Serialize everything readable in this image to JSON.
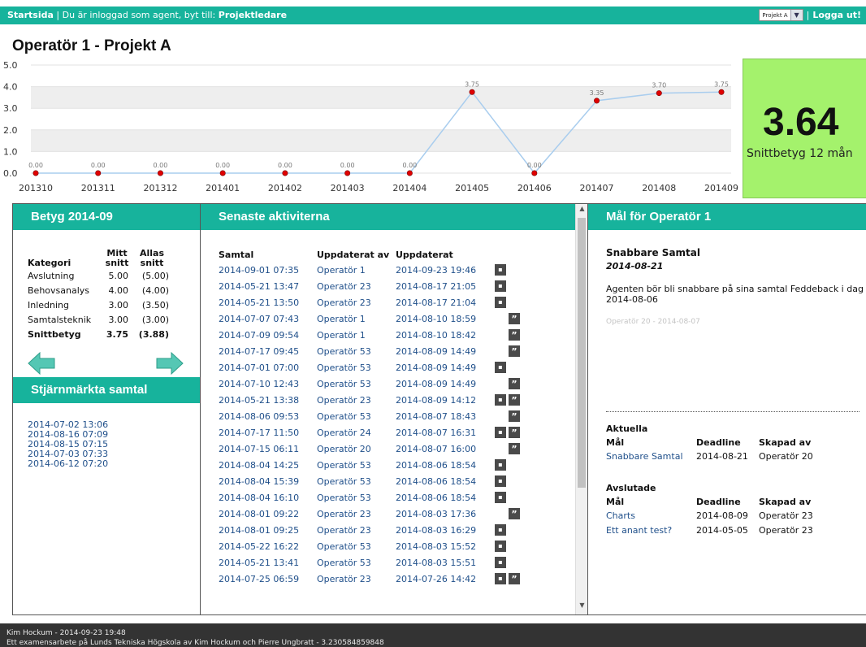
{
  "topbar": {
    "home_link": "Startsida",
    "separator": "|",
    "logged_in_text": "Du är inloggad som agent, byt till:",
    "switch_role": "Projektledare",
    "project_select": "Projekt A",
    "logout": "Logga ut!"
  },
  "page_title": "Operatör 1 - Projekt A",
  "chart_data": {
    "type": "line",
    "categories": [
      "201310",
      "201311",
      "201312",
      "201401",
      "201402",
      "201403",
      "201404",
      "201405",
      "201406",
      "201407",
      "201408",
      "201409"
    ],
    "values": [
      0.0,
      0.0,
      0.0,
      0.0,
      0.0,
      0.0,
      0.0,
      3.75,
      0.0,
      3.35,
      3.7,
      3.75
    ],
    "value_labels": [
      "0.00",
      "0.00",
      "0.00",
      "0.00",
      "0.00",
      "0.00",
      "0.00",
      "3.75",
      "0.00",
      "3.35",
      "3.70",
      "3.75"
    ],
    "y_ticks": [
      "0.0",
      "1.0",
      "2.0",
      "3.0",
      "4.0",
      "5.0"
    ],
    "ylim": [
      0,
      5
    ],
    "grid": true,
    "line_color": "#a9cdee",
    "point_color": "#e00000"
  },
  "score": {
    "value": "3.64",
    "caption": "Snittbetyg 12 mån"
  },
  "betyg": {
    "title": "Betyg 2014-09",
    "col_category": "Kategori",
    "col_mine": "Mitt snitt",
    "col_all": "Allas snitt",
    "rows": [
      {
        "category": "Avslutning",
        "mine": "5.00",
        "all": "(5.00)"
      },
      {
        "category": "Behovsanalys",
        "mine": "4.00",
        "all": "(4.00)"
      },
      {
        "category": "Inledning",
        "mine": "3.00",
        "all": "(3.50)"
      },
      {
        "category": "Samtalsteknik",
        "mine": "3.00",
        "all": "(3.00)"
      }
    ],
    "total": {
      "category": "Snittbetyg",
      "mine": "3.75",
      "all": "(3.88)"
    }
  },
  "starred": {
    "title": "Stjärnmärkta samtal",
    "items": [
      "2014-07-02 13:06",
      "2014-08-16 07:09",
      "2014-08-15 07:15",
      "2014-07-03 07:33",
      "2014-06-12 07:20"
    ]
  },
  "activities": {
    "title": "Senaste aktiviterna",
    "col_call": "Samtal",
    "col_updated_by": "Uppdaterat av",
    "col_updated": "Uppdaterat",
    "rows": [
      {
        "call": "2014-09-01 07:35",
        "by": "Operatör 1",
        "updated": "2014-09-23 19:46",
        "icons": [
          "stats"
        ]
      },
      {
        "call": "2014-05-21 13:47",
        "by": "Operatör 23",
        "updated": "2014-08-17 21:05",
        "icons": [
          "stats"
        ]
      },
      {
        "call": "2014-05-21 13:50",
        "by": "Operatör 23",
        "updated": "2014-08-17 21:04",
        "icons": [
          "stats"
        ]
      },
      {
        "call": "2014-07-07 07:43",
        "by": "Operatör 1",
        "updated": "2014-08-10 18:59",
        "icons": [
          "quote"
        ]
      },
      {
        "call": "2014-07-09 09:54",
        "by": "Operatör 1",
        "updated": "2014-08-10 18:42",
        "icons": [
          "quote"
        ]
      },
      {
        "call": "2014-07-17 09:45",
        "by": "Operatör 53",
        "updated": "2014-08-09 14:49",
        "icons": [
          "quote"
        ]
      },
      {
        "call": "2014-07-01 07:00",
        "by": "Operatör 53",
        "updated": "2014-08-09 14:49",
        "icons": [
          "stats"
        ]
      },
      {
        "call": "2014-07-10 12:43",
        "by": "Operatör 53",
        "updated": "2014-08-09 14:49",
        "icons": [
          "quote"
        ]
      },
      {
        "call": "2014-05-21 13:38",
        "by": "Operatör 23",
        "updated": "2014-08-09 14:12",
        "icons": [
          "stats",
          "quote"
        ]
      },
      {
        "call": "2014-08-06 09:53",
        "by": "Operatör 53",
        "updated": "2014-08-07 18:43",
        "icons": [
          "quote"
        ]
      },
      {
        "call": "2014-07-17 11:50",
        "by": "Operatör 24",
        "updated": "2014-08-07 16:31",
        "icons": [
          "stats",
          "quote"
        ]
      },
      {
        "call": "2014-07-15 06:11",
        "by": "Operatör 20",
        "updated": "2014-08-07 16:00",
        "icons": [
          "quote"
        ]
      },
      {
        "call": "2014-08-04 14:25",
        "by": "Operatör 53",
        "updated": "2014-08-06 18:54",
        "icons": [
          "stats"
        ]
      },
      {
        "call": "2014-08-04 15:39",
        "by": "Operatör 53",
        "updated": "2014-08-06 18:54",
        "icons": [
          "stats"
        ]
      },
      {
        "call": "2014-08-04 16:10",
        "by": "Operatör 53",
        "updated": "2014-08-06 18:54",
        "icons": [
          "stats"
        ]
      },
      {
        "call": "2014-08-01 09:22",
        "by": "Operatör 23",
        "updated": "2014-08-03 17:36",
        "icons": [
          "quote"
        ]
      },
      {
        "call": "2014-08-01 09:25",
        "by": "Operatör 23",
        "updated": "2014-08-03 16:29",
        "icons": [
          "stats"
        ]
      },
      {
        "call": "2014-05-22 16:22",
        "by": "Operatör 53",
        "updated": "2014-08-03 15:52",
        "icons": [
          "stats"
        ]
      },
      {
        "call": "2014-05-21 13:41",
        "by": "Operatör 53",
        "updated": "2014-08-03 15:51",
        "icons": [
          "stats"
        ]
      },
      {
        "call": "2014-07-25 06:59",
        "by": "Operatör 23",
        "updated": "2014-07-26 14:42",
        "icons": [
          "stats",
          "quote"
        ]
      }
    ]
  },
  "goals": {
    "title": "Mål för Operatör 1",
    "current_goal": {
      "title": "Snabbare Samtal",
      "date": "2014-08-21",
      "description": "Agenten bör bli snabbare på sina samtal Feddeback i dag 2014-08-06",
      "meta": "Operatör 20 - 2014-08-07"
    },
    "col_goal": "Mål",
    "col_deadline": "Deadline",
    "col_created_by": "Skapad av",
    "active_title": "Aktuella",
    "active": [
      {
        "goal": "Snabbare Samtal",
        "deadline": "2014-08-21",
        "created_by": "Operatör 20"
      }
    ],
    "finished_title": "Avslutade",
    "finished": [
      {
        "goal": "Charts",
        "deadline": "2014-08-09",
        "created_by": "Operatör 23"
      },
      {
        "goal": "Ett anant test?",
        "deadline": "2014-05-05",
        "created_by": "Operatör 23"
      }
    ]
  },
  "footer": {
    "line1": "Kim Hockum - 2014-09-23 19:48",
    "line2": "Ett examensarbete på Lunds Tekniska Högskola av Kim Hockum och Pierre Ungbratt - 3.230584859848"
  },
  "colors": {
    "accent": "#17b39c",
    "score_bg": "#a4f26c",
    "footer_bg": "#333333",
    "link": "#1f4f8a"
  }
}
